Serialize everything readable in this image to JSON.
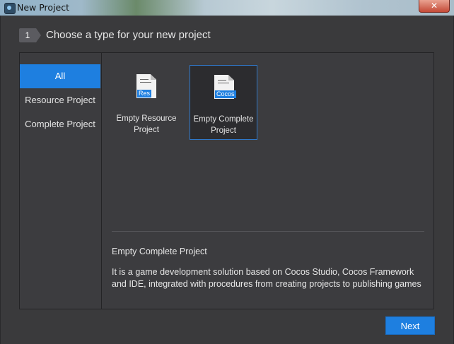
{
  "window": {
    "title": "New Project",
    "close_symbol": "✕"
  },
  "wizard": {
    "step_number": "1",
    "heading": "Choose a type for your new project"
  },
  "sidebar": {
    "items": [
      {
        "label": "All",
        "active": true
      },
      {
        "label": "Resource Project",
        "active": false
      },
      {
        "label": "Complete Project",
        "active": false
      }
    ]
  },
  "templates": [
    {
      "icon": "res-document-icon",
      "tag": "Res",
      "label": "Empty Resource Project",
      "selected": false
    },
    {
      "icon": "cocos-document-icon",
      "tag": "Cocos",
      "label": "Empty Complete Project",
      "selected": true
    }
  ],
  "description": {
    "title": "Empty Complete Project",
    "body": "It is a game development solution based on Cocos Studio, Cocos Framework and IDE, integrated with procedures from creating projects to publishing games"
  },
  "buttons": {
    "next_label": "Next"
  },
  "colors": {
    "accent": "#1e7fe0",
    "background": "#3a3a3c",
    "selected_border": "#2f78c9"
  }
}
